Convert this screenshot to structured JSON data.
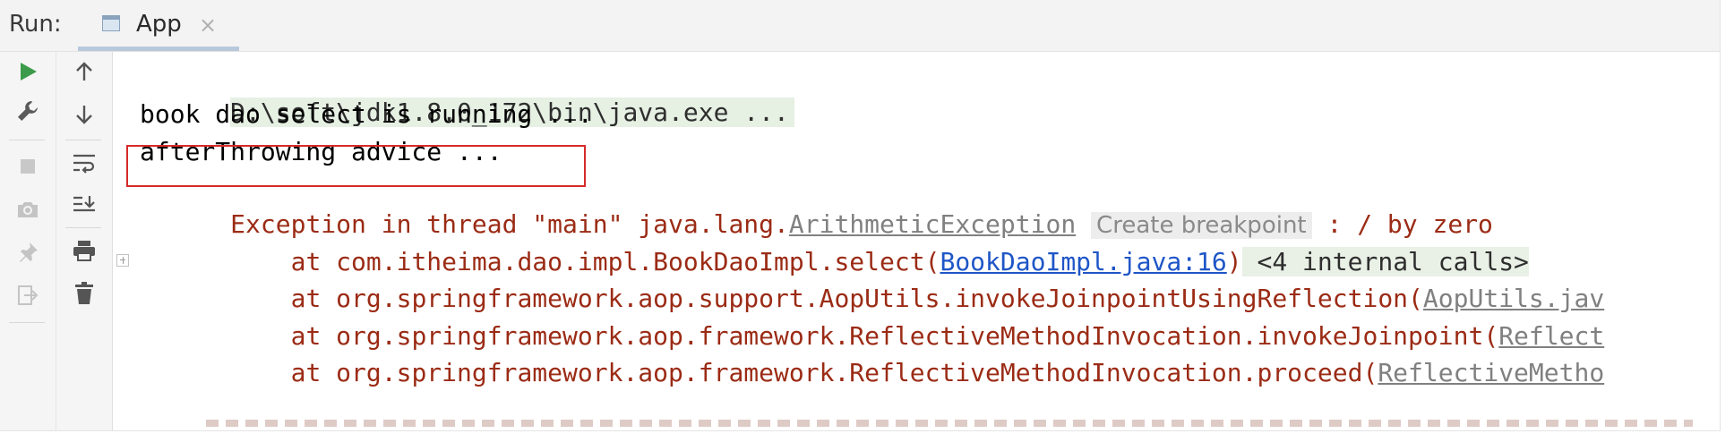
{
  "header": {
    "run_label": "Run:",
    "tab_title": "App",
    "tab_close": "×"
  },
  "toolbar_left": [
    "run-icon",
    "wrench-icon",
    "stop-icon",
    "camera-icon",
    "pin-icon",
    "exit-icon"
  ],
  "toolbar_right": [
    "arrow-up-icon",
    "arrow-down-icon",
    "soft-wrap-icon",
    "scroll-to-end-icon",
    "print-icon",
    "trash-icon"
  ],
  "console": {
    "cmd": "D:\\soft\\jdk1.8.0_172\\bin\\java.exe ...",
    "line1": "book dao select is running ...",
    "line2": "afterThrowing advice ...",
    "exception": {
      "prefix": "Exception in thread \"main\" java.lang.",
      "link": "ArithmeticException",
      "breakpoint": "Create breakpoint",
      "suffix": " : / by zero"
    },
    "trace": [
      {
        "prefix": "    at com.itheima.dao.impl.BookDaoImpl.select(",
        "link": "BookDaoImpl.java:16",
        "suffix": ")",
        "internal": " <4 internal calls>"
      },
      {
        "prefix": "    at org.springframework.aop.support.AopUtils.invokeJoinpointUsingReflection(",
        "link": "AopUtils.jav"
      },
      {
        "prefix": "    at org.springframework.aop.framework.ReflectiveMethodInvocation.invokeJoinpoint(",
        "link": "Reflect"
      },
      {
        "prefix": "    at org.springframework.aop.framework.ReflectiveMethodInvocation.proceed(",
        "link": "ReflectiveMetho"
      }
    ]
  },
  "colors": {
    "error_text": "#9b2b15",
    "link_blue": "#1f56c7",
    "highlight_border": "#d62a2a",
    "run_green": "#3c9b4a"
  }
}
